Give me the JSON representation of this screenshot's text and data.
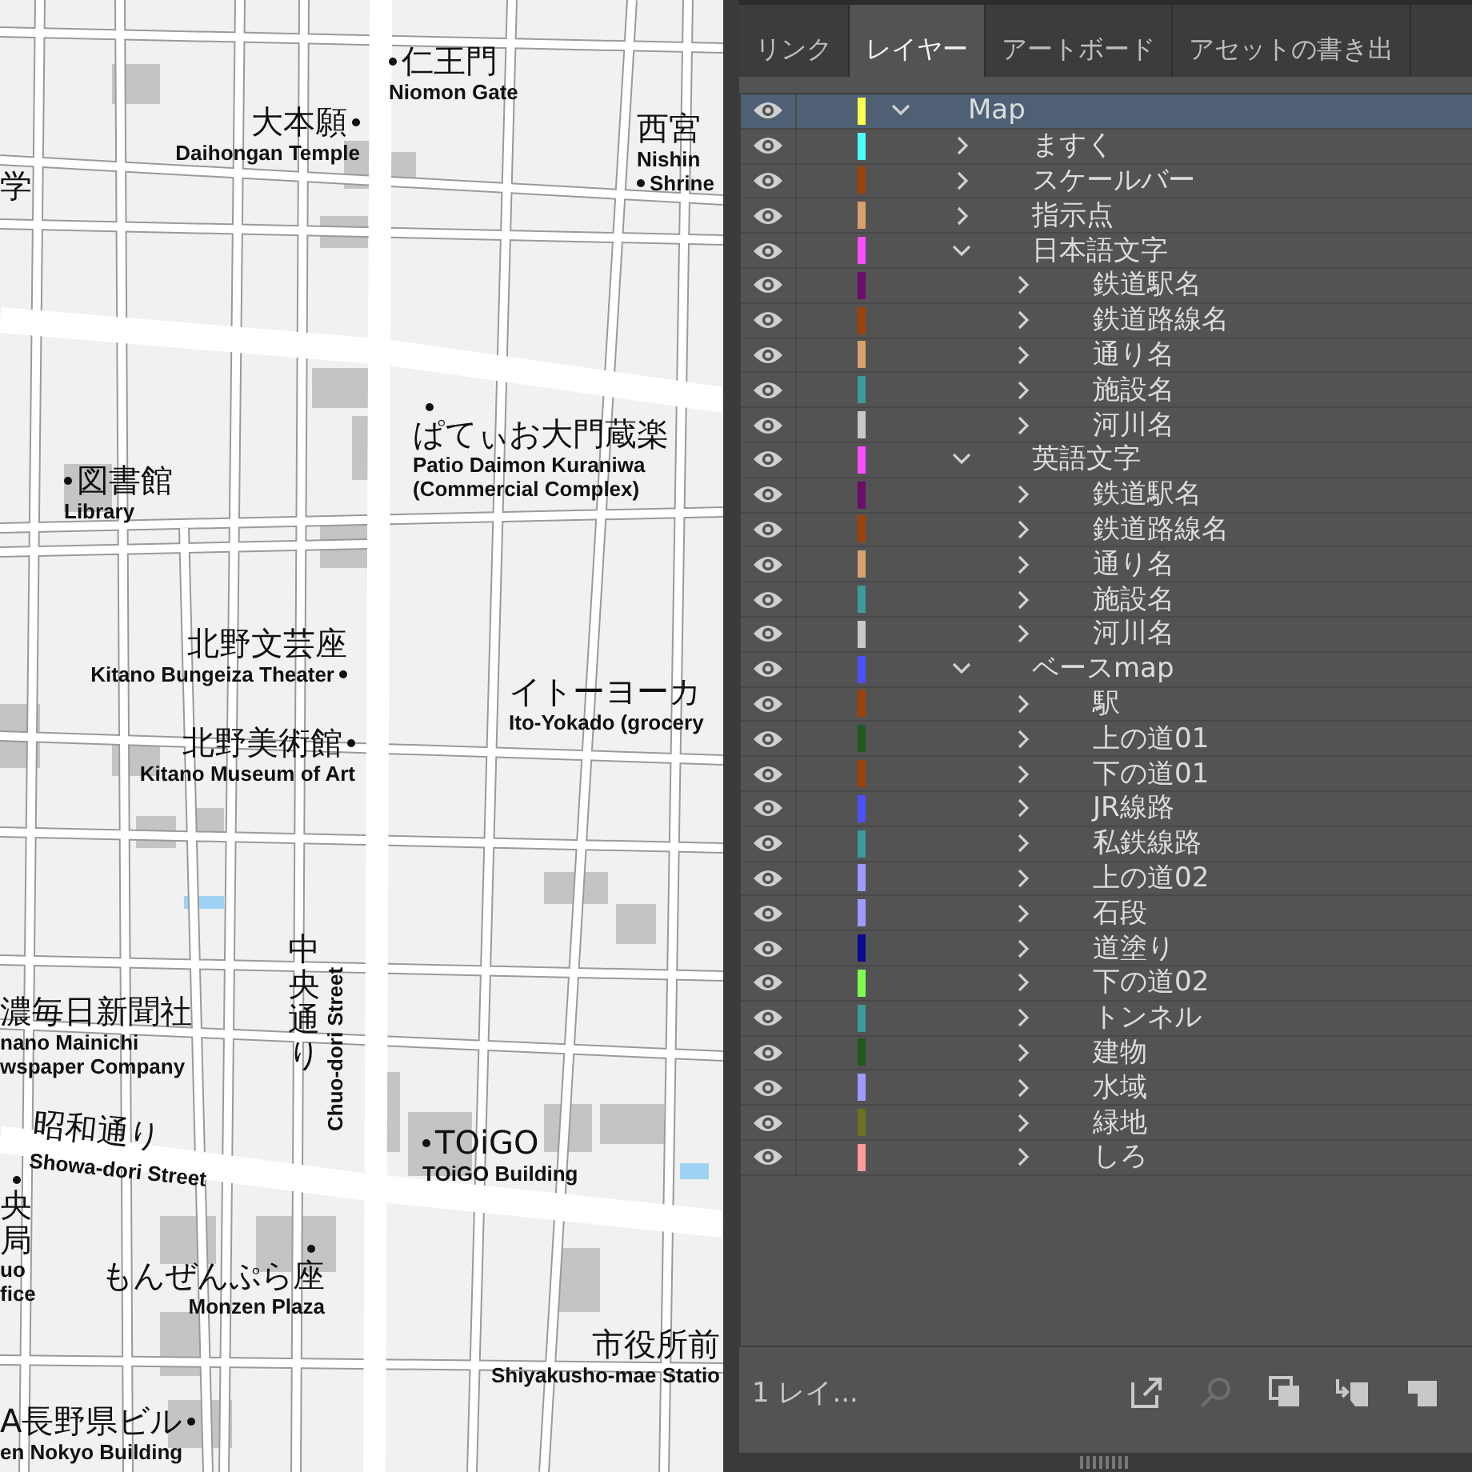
{
  "map": {
    "labels": [
      {
        "kind": "place",
        "jp": "仁王門",
        "en": [
          "Niomon Gate"
        ]
      },
      {
        "kind": "place",
        "jp": "学"
      },
      {
        "kind": "place",
        "jp": "大本願",
        "en": [
          "Daihongan Temple"
        ]
      },
      {
        "kind": "place",
        "jp": "西宮",
        "en": [
          "Nishin",
          "Shrine"
        ]
      },
      {
        "kind": "place",
        "jp": "ぱてぃお大門蔵楽",
        "en": [
          "Patio Daimon Kuraniwa",
          "(Commercial Complex)"
        ]
      },
      {
        "kind": "place",
        "jp": "図書館",
        "en": [
          "Library"
        ]
      },
      {
        "kind": "place",
        "jp": "北野文芸座",
        "en": [
          "Kitano Bungeiza Theater"
        ]
      },
      {
        "kind": "place",
        "jp": "北野美術館",
        "en": [
          "Kitano Museum of Art"
        ]
      },
      {
        "kind": "place",
        "jp": "イトーヨーカ",
        "en": [
          "Ito-Yokado (grocery"
        ]
      },
      {
        "kind": "street-vertical",
        "jp": "中央通り",
        "en": [
          "Chuo-dori Street"
        ]
      },
      {
        "kind": "place",
        "jp": "濃毎日新聞社",
        "en": [
          "nano Mainichi",
          "wspaper Company"
        ]
      },
      {
        "kind": "street-angled",
        "jp": "昭和通り",
        "en": [
          "Showa-dori Street"
        ]
      },
      {
        "kind": "place",
        "jp": "TOiGO",
        "en": [
          "TOiGO Building"
        ]
      },
      {
        "kind": "place-vertical",
        "jp": "央局",
        "en": [
          "uo",
          "fice"
        ]
      },
      {
        "kind": "place",
        "jp": "もんぜんぷら座",
        "en": [
          "Monzen Plaza"
        ]
      },
      {
        "kind": "place",
        "jp": "市役所前",
        "en": [
          "Shiyakusho-mae Statio"
        ]
      },
      {
        "kind": "place",
        "jp": "A長野県ビル",
        "en": [
          "en Nokyo Building"
        ]
      }
    ]
  },
  "panel": {
    "tabs": [
      {
        "label": "リンク",
        "selected": false
      },
      {
        "label": "レイヤー",
        "selected": true
      },
      {
        "label": "アートボード",
        "selected": false
      },
      {
        "label": "アセットの書き出",
        "selected": false
      }
    ],
    "layers": [
      {
        "name": "Map",
        "color": "#ffff4d",
        "visible": true,
        "selected": true,
        "expanded": true,
        "children": [
          {
            "name": "ますく",
            "color": "#4dffff",
            "visible": true,
            "selected": false,
            "expanded": false
          },
          {
            "name": "スケールバー",
            "color": "#a0410d",
            "visible": true,
            "selected": false,
            "expanded": false
          },
          {
            "name": "指示点",
            "color": "#d9a06c",
            "visible": true,
            "selected": false,
            "expanded": false
          },
          {
            "name": "日本語文字",
            "color": "#ff4dff",
            "visible": true,
            "selected": false,
            "expanded": true,
            "children": [
              {
                "name": "鉄道駅名",
                "color": "#6b0d6b",
                "visible": true,
                "selected": false,
                "expanded": false
              },
              {
                "name": "鉄道路線名",
                "color": "#a0410d",
                "visible": true,
                "selected": false,
                "expanded": false
              },
              {
                "name": "通り名",
                "color": "#d9a06c",
                "visible": true,
                "selected": false,
                "expanded": false
              },
              {
                "name": "施設名",
                "color": "#3c9c9c",
                "visible": true,
                "selected": false,
                "expanded": false
              },
              {
                "name": "河川名",
                "color": "#c8c8c8",
                "visible": true,
                "selected": false,
                "expanded": false
              }
            ]
          },
          {
            "name": "英語文字",
            "color": "#ff4dff",
            "visible": true,
            "selected": false,
            "expanded": true,
            "children": [
              {
                "name": "鉄道駅名",
                "color": "#6b0d6b",
                "visible": true,
                "selected": false,
                "expanded": false
              },
              {
                "name": "鉄道路線名",
                "color": "#a0410d",
                "visible": true,
                "selected": false,
                "expanded": false
              },
              {
                "name": "通り名",
                "color": "#d9a06c",
                "visible": true,
                "selected": false,
                "expanded": false
              },
              {
                "name": "施設名",
                "color": "#3c9c9c",
                "visible": true,
                "selected": false,
                "expanded": false
              },
              {
                "name": "河川名",
                "color": "#c8c8c8",
                "visible": true,
                "selected": false,
                "expanded": false
              }
            ]
          },
          {
            "name": "ベースmap",
            "color": "#4f4fff",
            "visible": true,
            "selected": false,
            "expanded": true,
            "children": [
              {
                "name": "駅",
                "color": "#a0410d",
                "visible": true,
                "selected": false,
                "expanded": false
              },
              {
                "name": "上の道01",
                "color": "#1e5a1e",
                "visible": true,
                "selected": false,
                "expanded": false
              },
              {
                "name": "下の道01",
                "color": "#a0410d",
                "visible": true,
                "selected": false,
                "expanded": false
              },
              {
                "name": "JR線路",
                "color": "#4f4fff",
                "visible": true,
                "selected": false,
                "expanded": false
              },
              {
                "name": "私鉄線路",
                "color": "#3c9c9c",
                "visible": true,
                "selected": false,
                "expanded": false
              },
              {
                "name": "上の道02",
                "color": "#9c9cff",
                "visible": true,
                "selected": false,
                "expanded": false
              },
              {
                "name": "石段",
                "color": "#9c9cff",
                "visible": true,
                "selected": false,
                "expanded": false
              },
              {
                "name": "道塗り",
                "color": "#0a0a8c",
                "visible": true,
                "selected": false,
                "expanded": false
              },
              {
                "name": "下の道02",
                "color": "#7cff4f",
                "visible": true,
                "selected": false,
                "expanded": false
              },
              {
                "name": "トンネル",
                "color": "#3c9c9c",
                "visible": true,
                "selected": false,
                "expanded": false
              },
              {
                "name": "建物",
                "color": "#1e5a1e",
                "visible": true,
                "selected": false,
                "expanded": false
              },
              {
                "name": "水域",
                "color": "#9c9cff",
                "visible": true,
                "selected": false,
                "expanded": false
              },
              {
                "name": "緑地",
                "color": "#707020",
                "visible": true,
                "selected": false,
                "expanded": false
              },
              {
                "name": "しろ",
                "color": "#ff9c9c",
                "visible": true,
                "selected": false,
                "expanded": false
              }
            ]
          }
        ]
      }
    ],
    "footer": {
      "count": "1 レイ..."
    }
  }
}
